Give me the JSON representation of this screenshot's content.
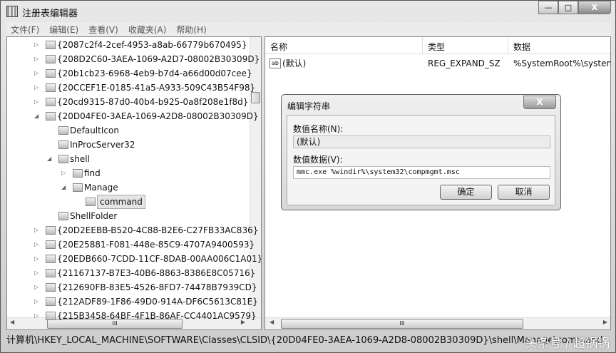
{
  "window": {
    "title": "注册表编辑器",
    "min": "—",
    "max": "□",
    "close": "X"
  },
  "menu": [
    "文件(F)",
    "编辑(E)",
    "查看(V)",
    "收藏夹(A)",
    "帮助(H)"
  ],
  "tree": [
    {
      "label": "{2087c2f4-2cef-4953-a8ab-66779b670495}",
      "level": 0,
      "exp": "▷"
    },
    {
      "label": "{208D2C60-3AEA-1069-A2D7-08002B30309D}",
      "level": 0,
      "exp": "▷"
    },
    {
      "label": "{20b1cb23-6968-4eb9-b7d4-a66d00d07cee}",
      "level": 0,
      "exp": "▷"
    },
    {
      "label": "{20CCEF1E-0185-41a5-A933-509C43B54F98}",
      "level": 0,
      "exp": "▷"
    },
    {
      "label": "{20cd9315-87d0-40b4-b925-0a8f208e1f8d}",
      "level": 0,
      "exp": "▷"
    },
    {
      "label": "{20D04FE0-3AEA-1069-A2D8-08002B30309D}",
      "level": 0,
      "exp": "◢"
    },
    {
      "label": "DefaultIcon",
      "level": 1,
      "exp": ""
    },
    {
      "label": "InProcServer32",
      "level": 1,
      "exp": ""
    },
    {
      "label": "shell",
      "level": 1,
      "exp": "◢"
    },
    {
      "label": "find",
      "level": 2,
      "exp": "▷"
    },
    {
      "label": "Manage",
      "level": 2,
      "exp": "◢"
    },
    {
      "label": "command",
      "level": 3,
      "exp": "",
      "selected": true
    },
    {
      "label": "ShellFolder",
      "level": 1,
      "exp": ""
    },
    {
      "label": "{20D2EEBB-B520-4C88-B2E6-C27FB33AC836}",
      "level": 0,
      "exp": "▷"
    },
    {
      "label": "{20E25881-F081-448e-85C9-4707A9400593}",
      "level": 0,
      "exp": "▷"
    },
    {
      "label": "{20EDB660-7CDD-11CF-8DAB-00AA006C1A01}",
      "level": 0,
      "exp": "▷"
    },
    {
      "label": "{21167137-B7E3-40B6-8863-8386E8C05716}",
      "level": 0,
      "exp": "▷"
    },
    {
      "label": "{212690FB-83E5-4526-8FD7-74478B7939CD}",
      "level": 0,
      "exp": "▷"
    },
    {
      "label": "{212ADF89-1F86-49D0-914A-DF6C5613C81E}",
      "level": 0,
      "exp": "▷"
    },
    {
      "label": "{215B3458-64BF-4F1B-86AF-CC4401AC9579}",
      "level": 0,
      "exp": "▷"
    }
  ],
  "list": {
    "headers": [
      "名称",
      "类型",
      "数据"
    ],
    "rows": [
      {
        "icon": "ab",
        "name": "(默认)",
        "type": "REG_EXPAND_SZ",
        "data": "%SystemRoot%\\system"
      }
    ]
  },
  "scroll": {
    "thumb": "III"
  },
  "status": "计算机\\HKEY_LOCAL_MACHINE\\SOFTWARE\\Classes\\CLSID\\{20D04FE0-3AEA-1069-A2D8-08002B30309D}\\shell\\Manage\\command",
  "watermark": "头条号 / 超锅锅",
  "dialog": {
    "title": "编辑字符串",
    "close": "X",
    "name_label": "数值名称(N):",
    "name_value": "(默认)",
    "data_label": "数值数据(V):",
    "data_value": "mmc.exe %windir%\\system32\\compmgmt.msc",
    "ok": "确定",
    "cancel": "取消"
  }
}
